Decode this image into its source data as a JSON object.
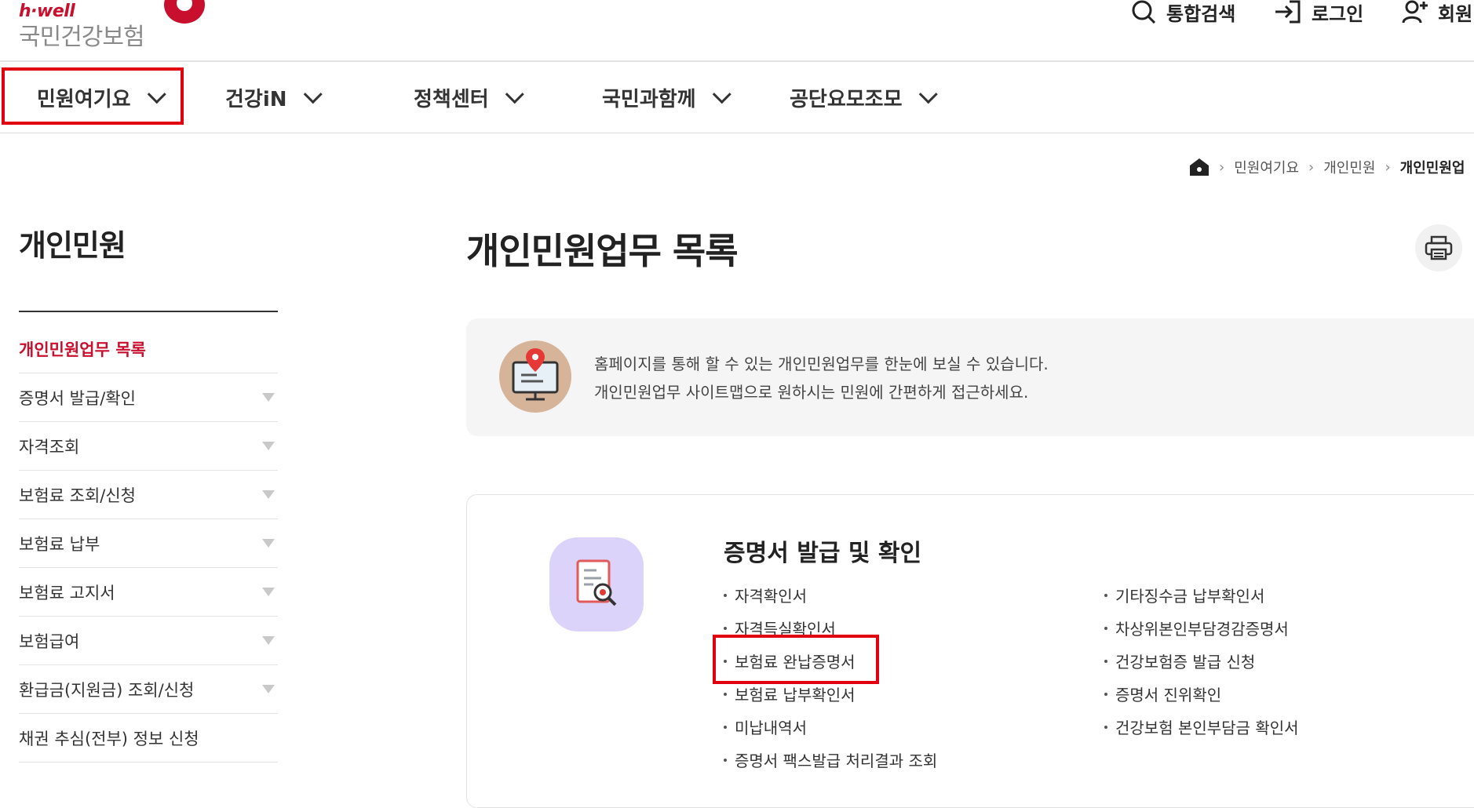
{
  "header": {
    "brand": "h·well",
    "org_name": "국민건강보험",
    "utilities": [
      {
        "label": "통합검색",
        "icon": "search-icon"
      },
      {
        "label": "로그인",
        "icon": "login-icon"
      },
      {
        "label": "회원",
        "icon": "user-add-icon"
      }
    ]
  },
  "gnb": [
    "민원여기요",
    "건강iN",
    "정책센터",
    "국민과함께",
    "공단요모조모"
  ],
  "breadcrumb": [
    "민원여기요",
    "개인민원",
    "개인민원업"
  ],
  "sidebar": {
    "title": "개인민원",
    "items": [
      {
        "label": "개인민원업무 목록"
      },
      {
        "label": "증명서 발급/확인"
      },
      {
        "label": "자격조회"
      },
      {
        "label": "보험료 조회/신청"
      },
      {
        "label": "보험료 납부"
      },
      {
        "label": "보험료 고지서"
      },
      {
        "label": "보험급여"
      },
      {
        "label": "환급금(지원금) 조회/신청"
      },
      {
        "label": "채권 추심(전부) 정보 신청"
      }
    ]
  },
  "main": {
    "title": "개인민원업무 목록",
    "info_lines": [
      "홈페이지를 통해 할 수 있는 개인민원업무를 한눈에 보실 수 있습니다.",
      "개인민원업무 사이트맵으로 원하시는 민원에 간편하게 접근하세요."
    ],
    "category": {
      "title": "증명서 발급 및 확인",
      "left_links": [
        "자격확인서",
        "자격득실확인서",
        "보험료 완납증명서",
        "보험료 납부확인서",
        "미납내역서",
        "증명서 팩스발급 처리결과 조회"
      ],
      "right_links": [
        "기타징수금 납부확인서",
        "차상위본인부담경감증명서",
        "건강보험증 발급 신청",
        "증명서 진위확인",
        "건강보험 본인부담금 확인서"
      ]
    }
  },
  "colors": {
    "accent": "#c8102e",
    "highlight": "#e0000f"
  }
}
